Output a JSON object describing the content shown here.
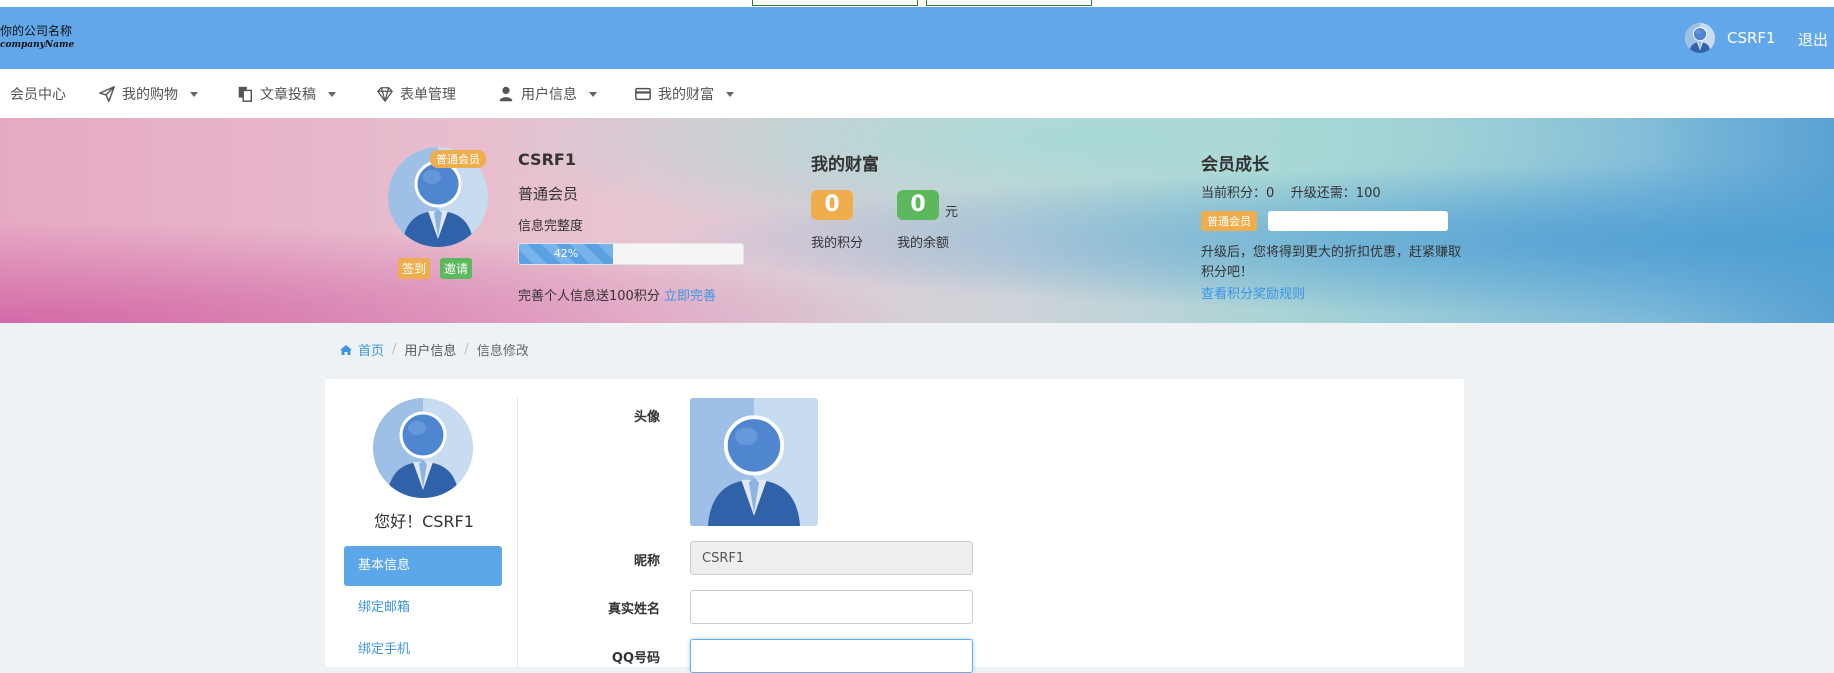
{
  "header": {
    "logo_line1": "你的公司名称",
    "logo_line2": "companyName",
    "username": "CSRF1",
    "logout": "退出"
  },
  "nav": {
    "items": [
      {
        "label": "会员中心",
        "icon": "",
        "has_caret": false
      },
      {
        "label": "我的购物",
        "icon": "paper-plane-icon",
        "has_caret": true
      },
      {
        "label": "文章投稿",
        "icon": "documents-icon",
        "has_caret": true
      },
      {
        "label": "表单管理",
        "icon": "diamond-icon",
        "has_caret": false
      },
      {
        "label": "用户信息",
        "icon": "user-icon",
        "has_caret": true
      },
      {
        "label": "我的财富",
        "icon": "credit-card-icon",
        "has_caret": true
      }
    ]
  },
  "banner": {
    "profile": {
      "name": "CSRF1",
      "level": "普通会员",
      "badge": "普通会员",
      "completeness_label": "信息完整度",
      "completeness_percent": 42,
      "completeness_text": "42%",
      "sign_in": "签到",
      "invite": "邀请",
      "tip": "完善个人信息送100积分",
      "tip_link": "立即完善"
    },
    "wealth": {
      "title": "我的财富",
      "points_value": "0",
      "points_label": "我的积分",
      "balance_value": "0",
      "balance_unit": "元",
      "balance_label": "我的余额"
    },
    "growth": {
      "title": "会员成长",
      "stats": "当前积分：0    升级还需：100",
      "badge": "普通会员",
      "text": "升级后，您将得到更大的折扣优惠，赶紧赚取积分吧！",
      "link": "查看积分奖励规则"
    }
  },
  "breadcrumb": {
    "home": "首页",
    "section": "用户信息",
    "current": "信息修改"
  },
  "sidebar": {
    "hello": "您好！CSRF1",
    "items": [
      {
        "label": "基本信息",
        "active": true
      },
      {
        "label": "绑定邮箱",
        "active": false
      },
      {
        "label": "绑定手机",
        "active": false
      }
    ]
  },
  "form": {
    "avatar_label": "头像",
    "nickname_label": "昵称",
    "nickname_value": "CSRF1",
    "realname_label": "真实姓名",
    "realname_value": "",
    "qq_label": "QQ号码",
    "qq_value": ""
  },
  "colors": {
    "header_bg": "#62a7ea",
    "accent": "#3b95e5",
    "orange": "#f0ad4e",
    "green": "#5cb85c"
  }
}
